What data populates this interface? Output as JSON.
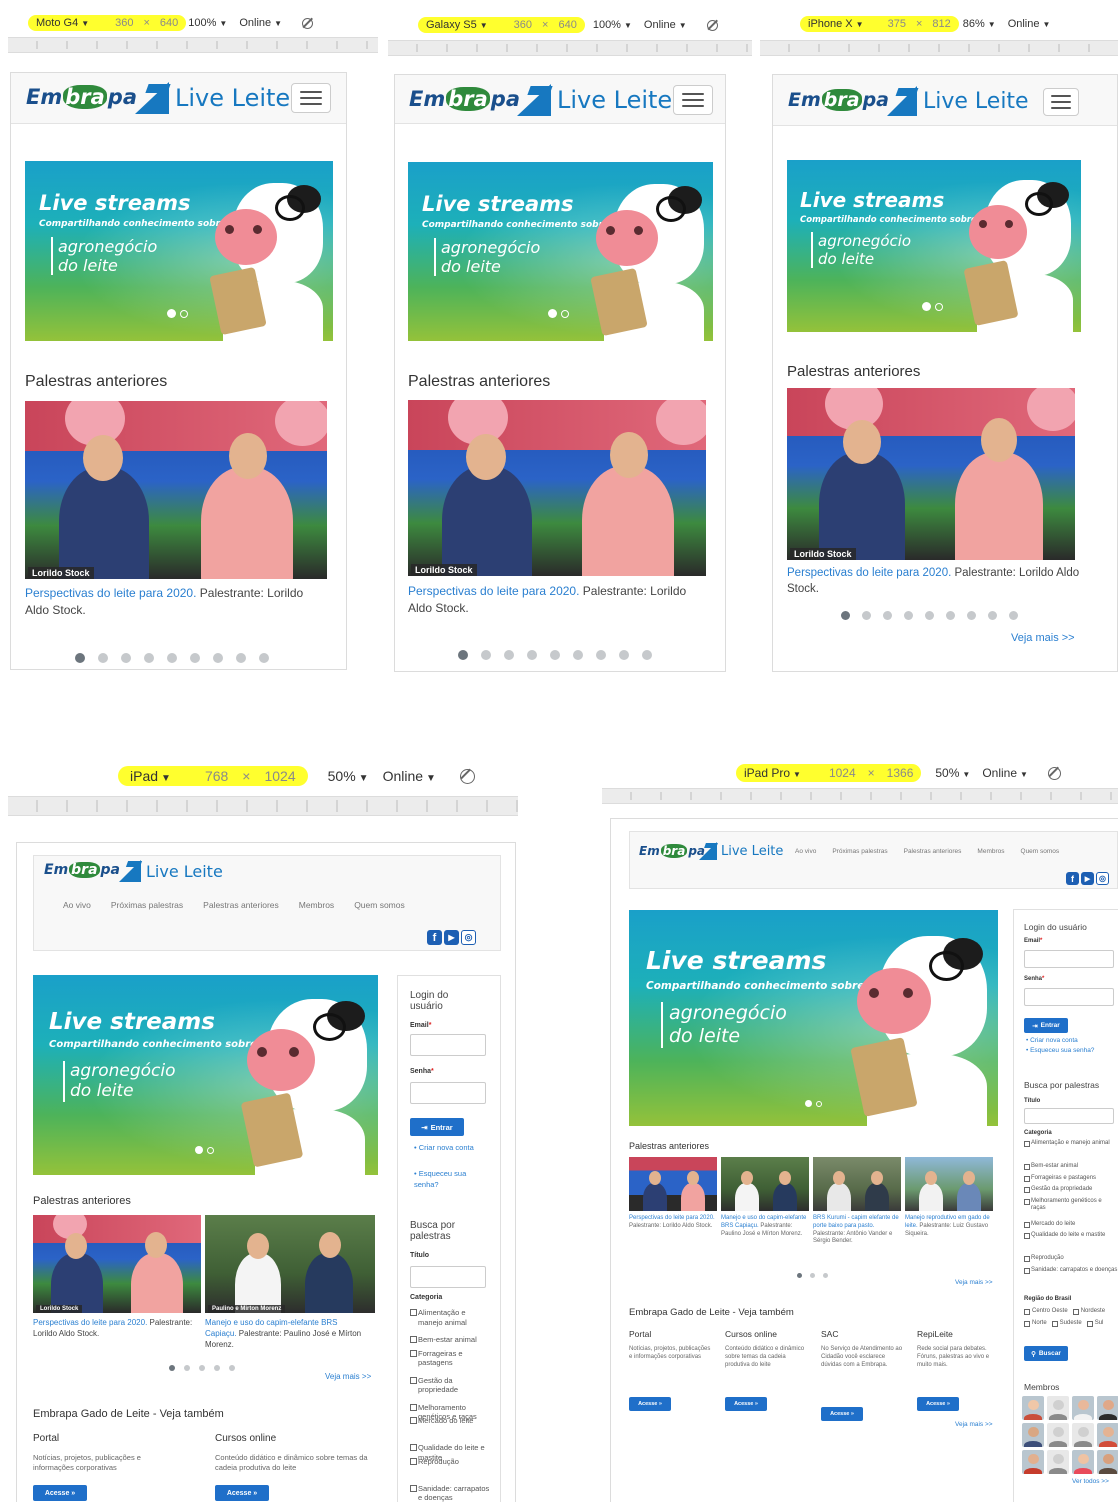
{
  "devices": [
    {
      "model": "Moto G4",
      "width": "360",
      "height": "640",
      "zoom": "100%",
      "network": "Online"
    },
    {
      "model": "Galaxy S5",
      "width": "360",
      "height": "640",
      "zoom": "100%",
      "network": "Online"
    },
    {
      "model": "iPhone X",
      "width": "375",
      "height": "812",
      "zoom": "86%",
      "network": "Online"
    },
    {
      "model": "iPad",
      "width": "768",
      "height": "1024",
      "zoom": "50%",
      "network": "Online"
    },
    {
      "model": "iPad Pro",
      "width": "1024",
      "height": "1366",
      "zoom": "50%",
      "network": "Online"
    }
  ],
  "toolbar": {
    "times": "×"
  },
  "brand": {
    "embrapa_a": "Em",
    "embrapa_b": "bra",
    "embrapa_c": "pa",
    "live": "Live Leite"
  },
  "banner": {
    "title": "Live streams",
    "subtitle": "Compartilhando conhecimento sobre o",
    "topic_1": "agronegócio",
    "topic_2": "do leite"
  },
  "section": {
    "previous": "Palestras anteriores",
    "see_more": "Veja mais >>",
    "see_also": "Embrapa Gado de Leite - Veja também"
  },
  "talks": [
    {
      "link": "Perspectivas do leite para 2020.",
      "rest": " Palestrante: Lorildo Aldo Stock.",
      "chip": "Lorildo Stock"
    },
    {
      "link": "Manejo e uso do capim-elefante BRS Capiaçu.",
      "rest": " Palestrante: Paulino José e Mírton Morenz.",
      "chip": "Paulino e Mirton Morenz"
    },
    {
      "link": "BRS Kurumi - capim elefante de porte baixo para pasto.",
      "rest": " Palestrante: Antônio Vander e Sérgio Bender."
    },
    {
      "link": "Manejo reprodutivo em gado de leite.",
      "rest": " Palestrante: Luiz Gustavo Siqueira."
    }
  ],
  "nav": {
    "items": [
      "Ao vivo",
      "Próximas palestras",
      "Palestras anteriores",
      "Membros",
      "Quem somos"
    ]
  },
  "social": {
    "facebook": "f",
    "youtube": "▶",
    "instagram": "◎"
  },
  "login": {
    "title": "Login do usuário",
    "email": "Email",
    "password": "Senha",
    "required": "*",
    "submit": "Entrar",
    "create": "Criar nova conta",
    "forgot": "Esqueceu sua senha?"
  },
  "search": {
    "title": "Busca por palestras",
    "field_title": "Título",
    "category": "Categoria",
    "categories": [
      "Alimentação e manejo animal",
      "Bem-estar animal",
      "Forrageiras e pastagens",
      "Gestão da propriedade",
      "Melhoramento genéticos e raças",
      "Mercado do leite",
      "Qualidade do leite e mastite",
      "Reprodução",
      "Sanidade: carrapatos e doenças"
    ],
    "region": "Região do Brasil",
    "regions": [
      "Centro Oeste",
      "Nordeste",
      "Norte",
      "Sudeste",
      "Sul"
    ],
    "submit": "Buscar"
  },
  "see_also": [
    {
      "title": "Portal",
      "text": "Notícias, projetos, publicações e informações corporativas",
      "button": "Acesse »"
    },
    {
      "title": "Cursos online",
      "text": "Conteúdo didático e dinâmico sobre temas da cadeia produtiva do leite",
      "button": "Acesse »"
    },
    {
      "title": "SAC",
      "text": "No Serviço de Atendimento ao Cidadão você esclarece dúvidas com a Embrapa.",
      "button": "Acesse »"
    },
    {
      "title": "RepiLeite",
      "text": "Rede social para debates. Fóruns, palestras ao vivo e muito mais.",
      "button": "Acesse »"
    }
  ],
  "members": {
    "title": "Membros",
    "see_all": "Ver todos >>"
  },
  "pagination": {
    "phone_dots": 9,
    "active": 1,
    "ipad_dots": 5,
    "pro_dots": 3
  },
  "colors": {
    "link": "#2a7fd0",
    "button": "#1f6fc9",
    "highlight": "#ffff2e",
    "brand_green": "#2f8a3c",
    "brand_blue": "#1a4f8c"
  }
}
